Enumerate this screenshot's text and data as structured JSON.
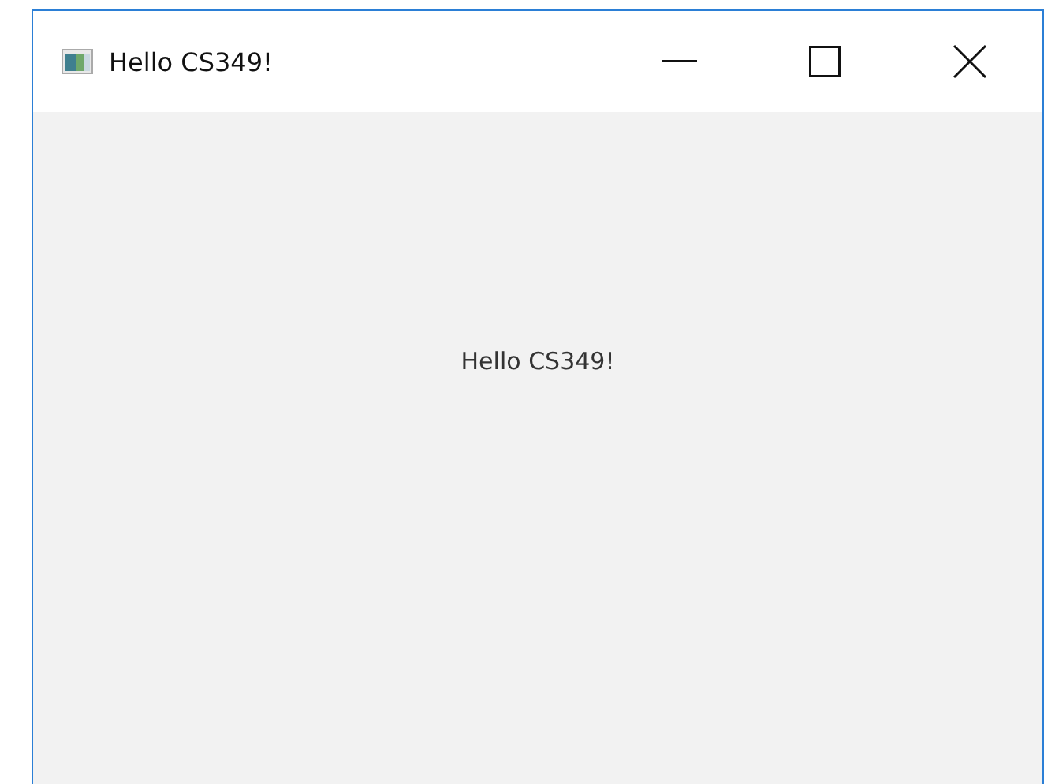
{
  "window": {
    "title": "Hello CS349!"
  },
  "content": {
    "label": "Hello CS349!"
  }
}
